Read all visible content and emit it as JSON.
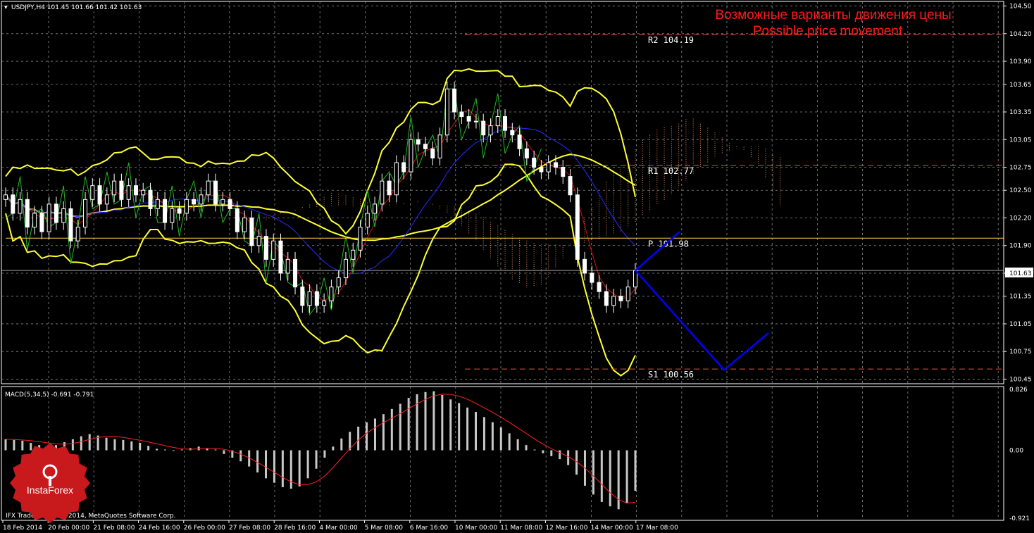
{
  "header": {
    "symbol_info": "USDJPY,H4  101.45 101.66 101.42 101.63",
    "title_ru": "Возможные варианты движения цены",
    "title_en": "Possible price movement"
  },
  "levels": [
    {
      "label": "R2  104.19",
      "price": 104.19,
      "color": "#d9553a",
      "style": "dashed"
    },
    {
      "label": "R1  102.77",
      "price": 102.77,
      "color": "#d9553a",
      "style": "dashed"
    },
    {
      "label": "P  101.98",
      "price": 101.98,
      "color": "#ffd23c",
      "style": "solid"
    },
    {
      "label": "S1  100.56",
      "price": 100.56,
      "color": "#d9553a",
      "style": "dashed"
    }
  ],
  "current_price": {
    "label": "101.63",
    "value": 101.63
  },
  "macd": {
    "label": "MACD(5,34,5) -0.691 -0.791",
    "ticks": [
      "0.826",
      "0.00",
      "-0.921"
    ],
    "range": [
      -0.921,
      0.826
    ]
  },
  "copyright": "IFX Trader, © 2001-2014, MetaQuotes Software Corp.",
  "brand": {
    "name": "InstaForex",
    "color": "#c8191d"
  },
  "chart_data": {
    "type": "candlestick",
    "symbol": "USDJPY",
    "timeframe": "H4",
    "y_ticks": [
      "104.50",
      "104.20",
      "103.90",
      "103.65",
      "103.35",
      "103.05",
      "102.75",
      "102.50",
      "102.20",
      "101.90",
      "101.60",
      "101.35",
      "101.05",
      "100.75",
      "100.45"
    ],
    "ylim": [
      100.4,
      104.55
    ],
    "x_ticks": [
      "18 Feb 2014",
      "20 Feb 00:00",
      "21 Feb 08:00",
      "24 Feb 16:00",
      "26 Feb 00:00",
      "27 Feb 08:00",
      "28 Feb 16:00",
      "4 Mar 00:00",
      "5 Mar 08:00",
      "6 Mar 16:00",
      "10 Mar 00:00",
      "11 Mar 08:00",
      "12 Mar 16:00",
      "14 Mar 00:00",
      "17 Mar 08:00"
    ],
    "close": [
      102.45,
      102.25,
      102.4,
      102.1,
      102.25,
      102.05,
      102.35,
      102.15,
      102.3,
      101.95,
      102.1,
      102.4,
      102.55,
      102.35,
      102.45,
      102.6,
      102.4,
      102.55,
      102.45,
      102.5,
      102.3,
      102.4,
      102.15,
      102.3,
      102.25,
      102.4,
      102.35,
      102.45,
      102.6,
      102.35,
      102.4,
      102.3,
      102.05,
      102.2,
      101.9,
      102.0,
      101.75,
      101.95,
      101.6,
      101.75,
      101.45,
      101.25,
      101.4,
      101.25,
      101.3,
      101.45,
      101.55,
      101.75,
      101.85,
      102.1,
      102.25,
      102.35,
      102.6,
      102.45,
      102.8,
      102.7,
      103.05,
      103.0,
      102.95,
      102.85,
      103.1,
      103.6,
      103.35,
      103.3,
      103.25,
      103.25,
      103.1,
      103.2,
      103.3,
      103.15,
      103.1,
      102.95,
      102.85,
      102.75,
      102.7,
      102.8,
      102.75,
      102.65,
      102.45,
      101.75,
      101.6,
      101.5,
      101.4,
      101.25,
      101.35,
      101.3,
      101.45,
      101.63
    ],
    "forecast": {
      "series": [
        {
          "name": "",
          "color": "#0000ff",
          "points": [
            [
              101.63,
              0
            ],
            [
              102.05,
              1
            ]
          ]
        },
        {
          "name": "",
          "color": "#0000ff",
          "points": [
            [
              101.63,
              0
            ],
            [
              100.55,
              2
            ],
            [
              100.95,
              3
            ]
          ]
        }
      ]
    },
    "macd_histogram": [
      0.15,
      0.14,
      0.13,
      0.1,
      0.07,
      0.06,
      0.07,
      0.11,
      0.15,
      0.19,
      0.22,
      0.2,
      0.17,
      0.15,
      0.14,
      0.12,
      0.1,
      0.06,
      0.02,
      0.01,
      0.0,
      0.01,
      0.03,
      0.05,
      0.03,
      0.01,
      -0.05,
      -0.1,
      -0.15,
      -0.22,
      -0.3,
      -0.38,
      -0.44,
      -0.5,
      -0.52,
      -0.49,
      -0.38,
      -0.25,
      -0.1,
      0.05,
      0.16,
      0.25,
      0.32,
      0.38,
      0.43,
      0.49,
      0.56,
      0.63,
      0.71,
      0.76,
      0.79,
      0.8,
      0.75,
      0.69,
      0.64,
      0.58,
      0.52,
      0.45,
      0.38,
      0.31,
      0.23,
      0.15,
      0.07,
      0.01,
      -0.04,
      -0.08,
      -0.12,
      -0.2,
      -0.33,
      -0.48,
      -0.6,
      -0.7,
      -0.76,
      -0.8,
      -0.72,
      -0.55
    ]
  }
}
